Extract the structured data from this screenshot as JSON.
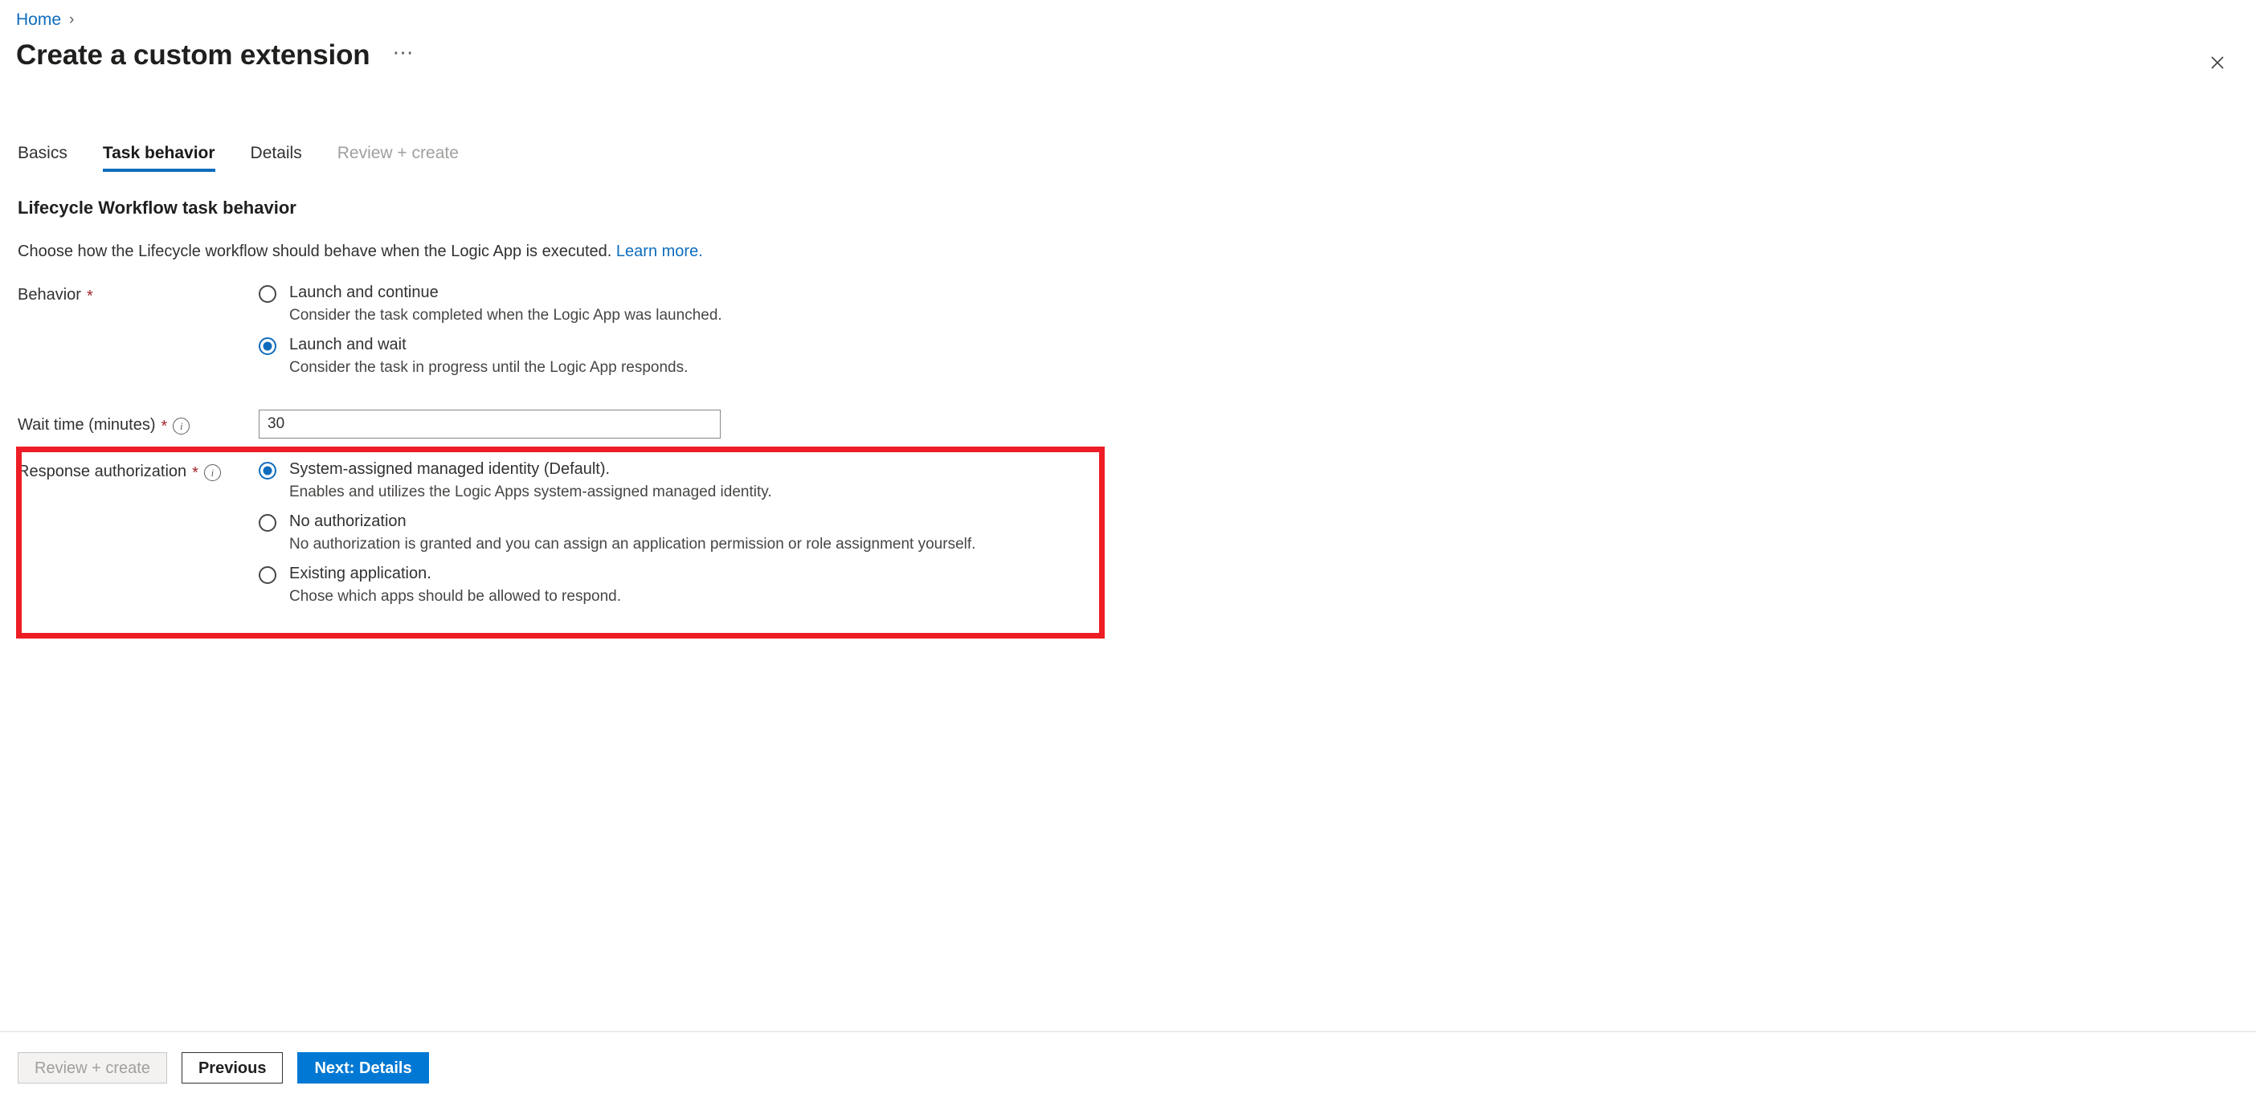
{
  "breadcrumb": {
    "home_label": "Home",
    "separator": "›"
  },
  "header": {
    "title": "Create a custom extension",
    "more_label": "⋯",
    "close_icon": "close-icon"
  },
  "tabs": [
    {
      "label": "Basics",
      "state": "enabled"
    },
    {
      "label": "Task behavior",
      "state": "active"
    },
    {
      "label": "Details",
      "state": "enabled"
    },
    {
      "label": "Review + create",
      "state": "disabled"
    }
  ],
  "section": {
    "heading": "Lifecycle Workflow task behavior",
    "description": "Choose how the Lifecycle workflow should behave when the Logic App is executed.",
    "learn_more_label": "Learn more."
  },
  "behavior": {
    "label": "Behavior",
    "required_marker": "*",
    "options": [
      {
        "title": "Launch and continue",
        "description": "Consider the task completed when the Logic App was launched.",
        "selected": false
      },
      {
        "title": "Launch and wait",
        "description": "Consider the task in progress until the Logic App responds.",
        "selected": true
      }
    ]
  },
  "wait_time": {
    "label": "Wait time (minutes)",
    "required_marker": "*",
    "info_icon": "info-icon",
    "value": "30",
    "placeholder": ""
  },
  "response_authorization": {
    "label": "Response authorization",
    "required_marker": "*",
    "info_icon": "info-icon",
    "highlighted": true,
    "highlight_color": "#ee1d25",
    "options": [
      {
        "title": "System-assigned managed identity (Default).",
        "description": "Enables and utilizes the Logic Apps system-assigned managed identity.",
        "selected": true
      },
      {
        "title": "No authorization",
        "description": "No authorization is granted and you can assign an application permission or role assignment yourself.",
        "selected": false
      },
      {
        "title": "Existing application.",
        "description": "Chose which apps should be allowed to respond.",
        "selected": false
      }
    ]
  },
  "footer": {
    "review_create_label": "Review + create",
    "previous_label": "Previous",
    "next_label": "Next: Details"
  },
  "colors": {
    "accent": "#0078d4",
    "link": "#0f6cbd",
    "required": "#a4262c",
    "highlight": "#ee1d25"
  }
}
